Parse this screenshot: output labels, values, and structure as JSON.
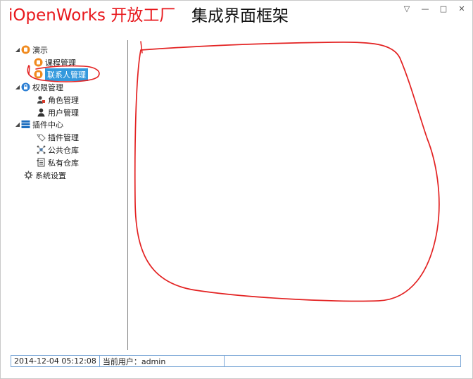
{
  "header": {
    "brand": "iOpenWorks 开放工厂",
    "subtitle": "集成界面框架",
    "controls": [
      {
        "icon": "dropdown-icon",
        "glyph": "▽"
      },
      {
        "icon": "minimize-icon",
        "glyph": "—"
      },
      {
        "icon": "maximize-icon",
        "glyph": "□"
      },
      {
        "icon": "close-icon",
        "glyph": "✕"
      }
    ]
  },
  "tree": {
    "items": [
      {
        "label": "演示",
        "icon": "demo-icon",
        "expanded": true
      },
      {
        "label": "课程管理",
        "icon": "course-icon"
      },
      {
        "label": "联系人管理",
        "icon": "contact-icon",
        "selected": true
      },
      {
        "label": "权限管理",
        "icon": "lock-icon",
        "expanded": true
      },
      {
        "label": "角色管理",
        "icon": "role-icon"
      },
      {
        "label": "用户管理",
        "icon": "user-icon"
      },
      {
        "label": "插件中心",
        "icon": "plugin-center-icon",
        "expanded": true
      },
      {
        "label": "插件管理",
        "icon": "plugin-icon"
      },
      {
        "label": "公共仓库",
        "icon": "public-repo-icon"
      },
      {
        "label": "私有仓库",
        "icon": "private-repo-icon"
      },
      {
        "label": "系统设置",
        "icon": "gear-icon"
      }
    ]
  },
  "status": {
    "datetime": "2014-12-04 05:12:08",
    "current_user": "当前用户：admin",
    "extra": ""
  },
  "colors": {
    "brand": "#e8171c",
    "selection": "#3399dd",
    "annotation": "#e32222",
    "status_border": "#7aa6d6"
  }
}
